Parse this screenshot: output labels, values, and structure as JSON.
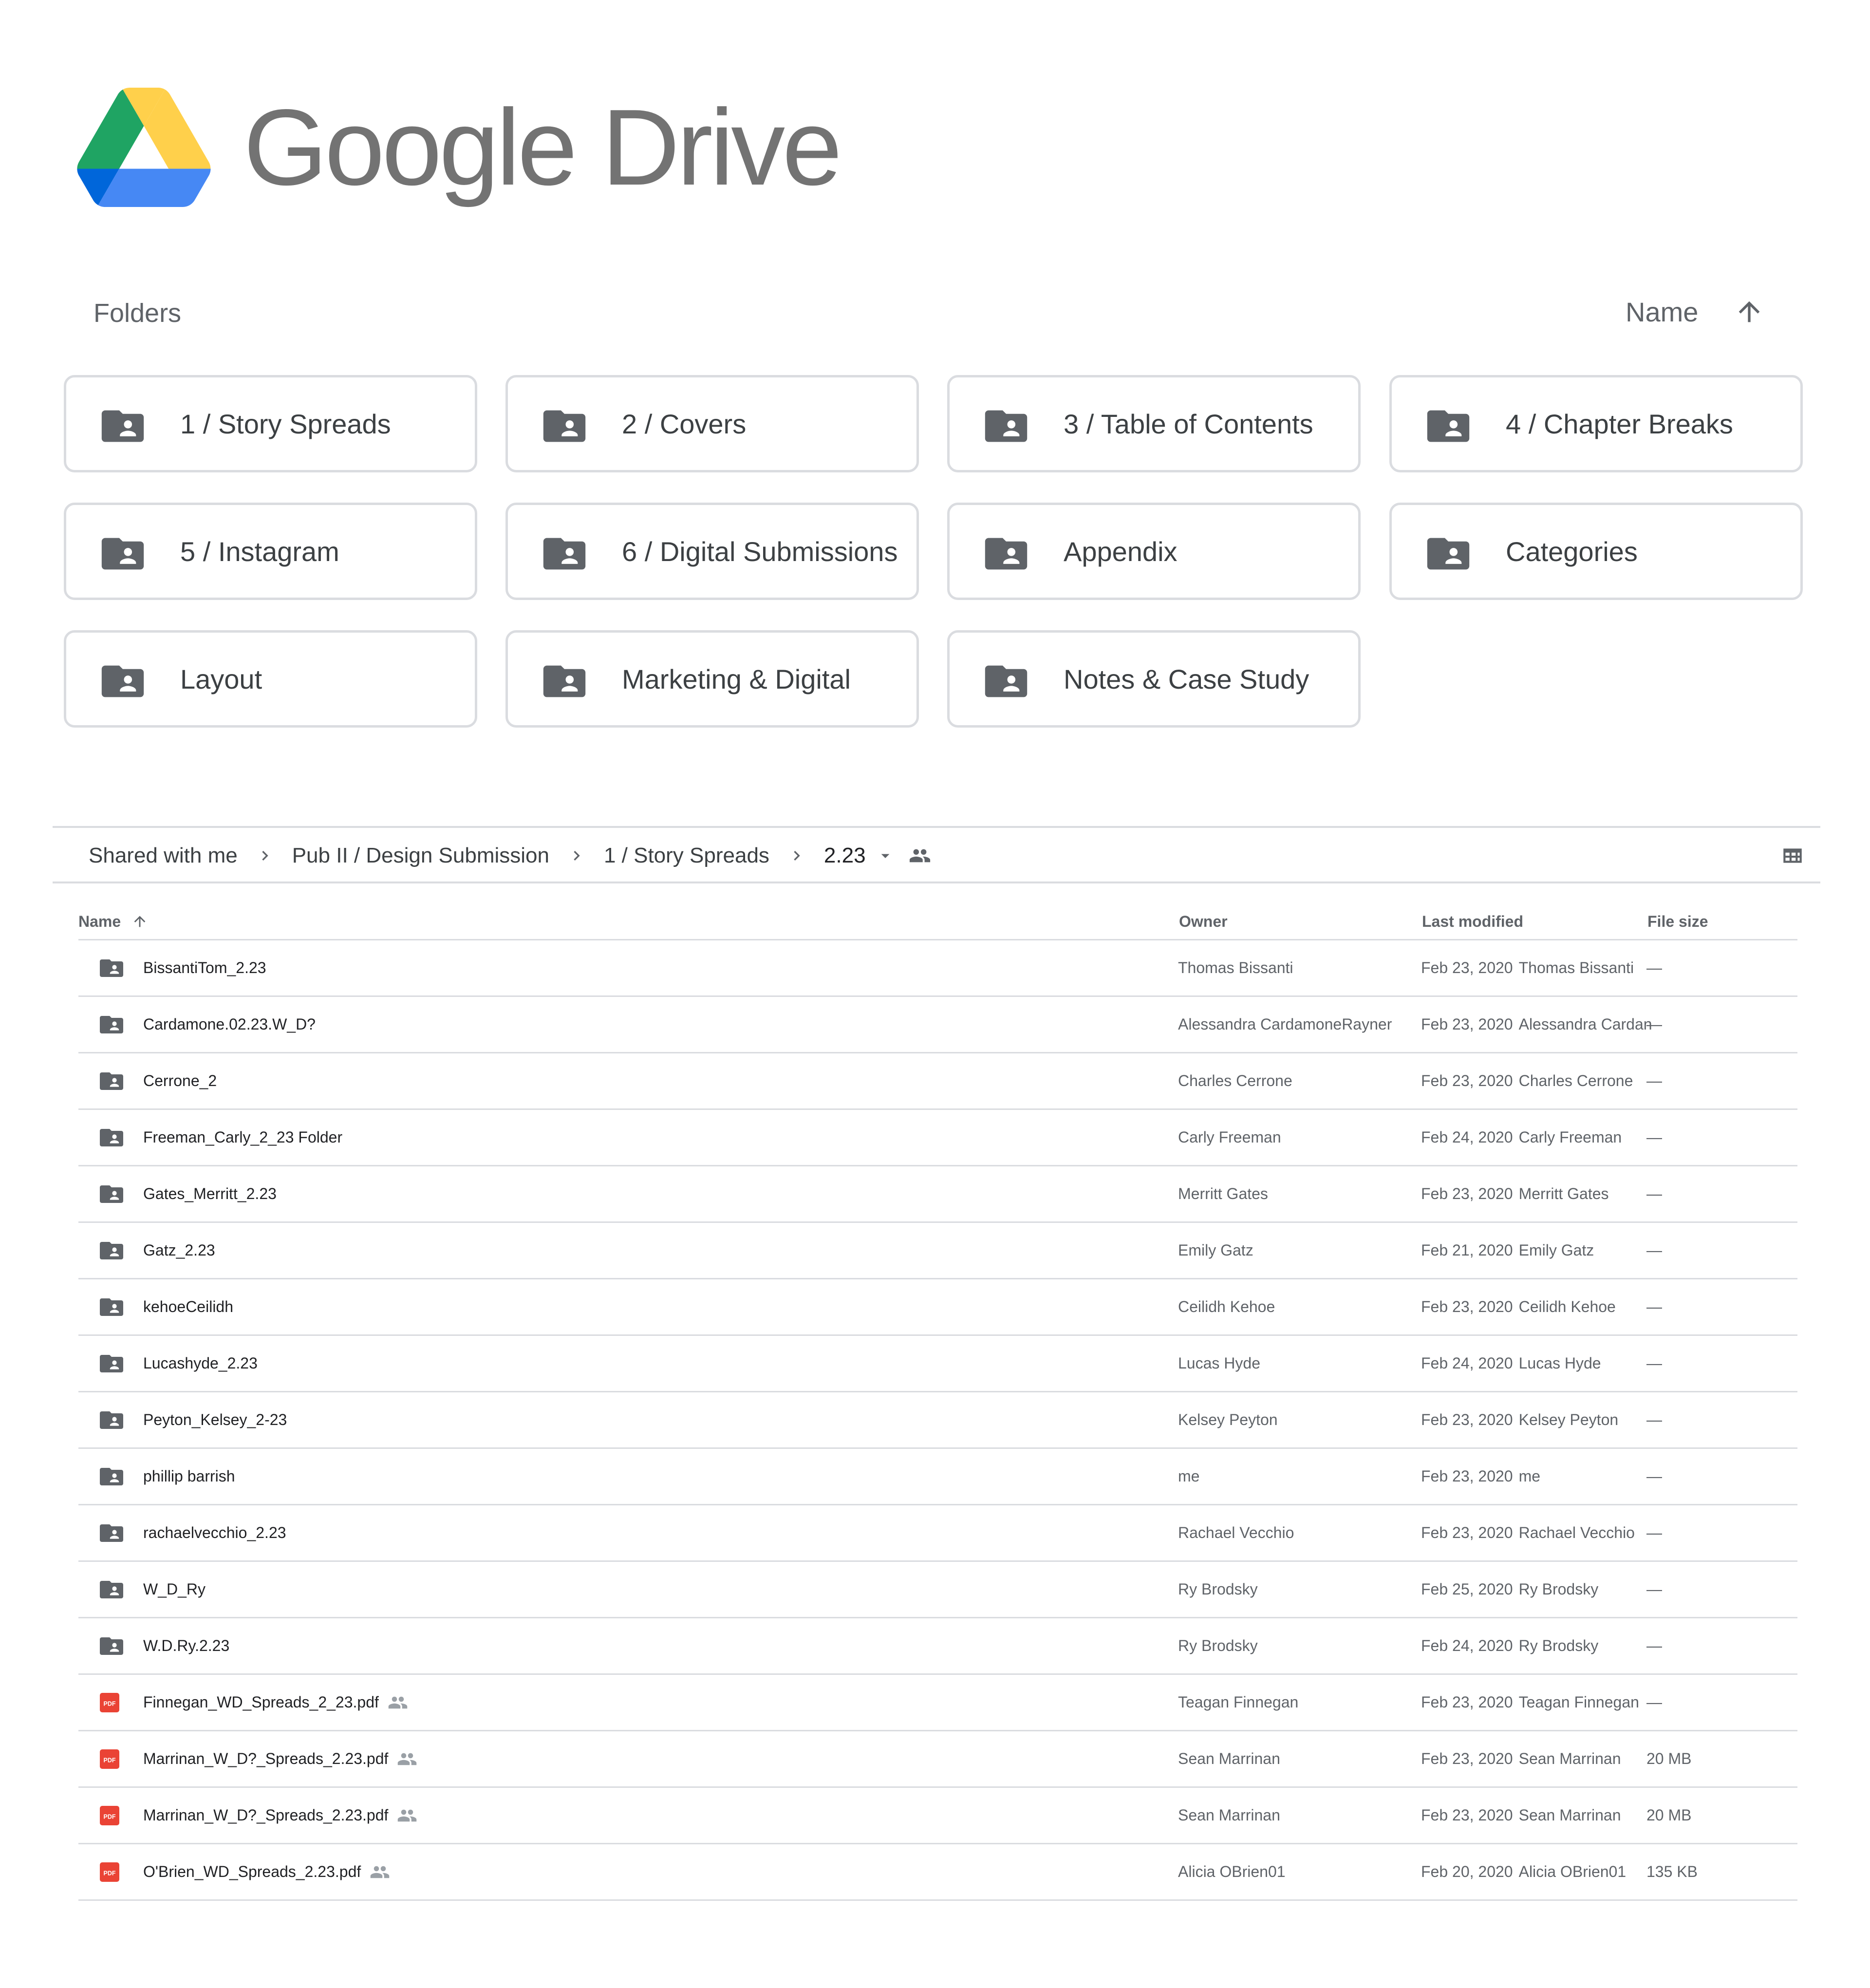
{
  "brand": {
    "name": "Google Drive",
    "logo_icon": "google-drive-logo",
    "colors": {
      "green": "#1FA463",
      "yellow": "#FFD04B",
      "blue": "#4688F4",
      "text": "#737373"
    }
  },
  "folders_section": {
    "label": "Folders",
    "sort_label": "Name",
    "sort_icon": "arrow-up-icon",
    "folders": [
      {
        "label": "1 / Story Spreads"
      },
      {
        "label": "2 / Covers"
      },
      {
        "label": "3 / Table of Contents"
      },
      {
        "label": "4 / Chapter Breaks"
      },
      {
        "label": "5 / Instagram"
      },
      {
        "label": "6 / Digital Submissions"
      },
      {
        "label": "Appendix"
      },
      {
        "label": "Categories"
      },
      {
        "label": "Layout"
      },
      {
        "label": "Marketing & Digital"
      },
      {
        "label": "Notes & Case Study"
      }
    ]
  },
  "breadcrumb": {
    "items": [
      "Shared with me",
      "Pub II / Design Submission",
      "1 / Story Spreads"
    ],
    "current": "2.23",
    "separator_icon": "chevron-right-icon",
    "dropdown_icon": "caret-down-icon",
    "shared_icon": "people-icon",
    "view_toggle_icon": "grid-view-icon"
  },
  "file_list": {
    "columns": {
      "name": "Name",
      "owner": "Owner",
      "last_modified": "Last modified",
      "file_size": "File size"
    },
    "rows": [
      {
        "type": "shared-folder",
        "name": "BissantiTom_2.23",
        "shared": false,
        "owner": "Thomas Bissanti",
        "modified_date": "Feb 23, 2020",
        "modified_by": "Thomas Bissanti",
        "size": "—"
      },
      {
        "type": "shared-folder",
        "name": "Cardamone.02.23.W_D?",
        "shared": false,
        "owner": "Alessandra CardamoneRayner",
        "modified_date": "Feb 23, 2020",
        "modified_by": "Alessandra Cardan",
        "size": "—"
      },
      {
        "type": "shared-folder",
        "name": "Cerrone_2",
        "shared": false,
        "owner": "Charles Cerrone",
        "modified_date": "Feb 23, 2020",
        "modified_by": "Charles Cerrone",
        "size": "—"
      },
      {
        "type": "shared-folder",
        "name": "Freeman_Carly_2_23 Folder",
        "shared": false,
        "owner": "Carly Freeman",
        "modified_date": "Feb 24, 2020",
        "modified_by": "Carly Freeman",
        "size": "—"
      },
      {
        "type": "shared-folder",
        "name": "Gates_Merritt_2.23",
        "shared": false,
        "owner": "Merritt Gates",
        "modified_date": "Feb 23, 2020",
        "modified_by": "Merritt Gates",
        "size": "—"
      },
      {
        "type": "shared-folder",
        "name": "Gatz_2.23",
        "shared": false,
        "owner": "Emily Gatz",
        "modified_date": "Feb 21, 2020",
        "modified_by": "Emily Gatz",
        "size": "—"
      },
      {
        "type": "shared-folder",
        "name": "kehoeCeilidh",
        "shared": false,
        "owner": "Ceilidh Kehoe",
        "modified_date": "Feb 23, 2020",
        "modified_by": "Ceilidh Kehoe",
        "size": "—"
      },
      {
        "type": "shared-folder",
        "name": "Lucashyde_2.23",
        "shared": false,
        "owner": "Lucas Hyde",
        "modified_date": "Feb 24, 2020",
        "modified_by": "Lucas Hyde",
        "size": "—"
      },
      {
        "type": "shared-folder",
        "name": "Peyton_Kelsey_2-23",
        "shared": false,
        "owner": "Kelsey Peyton",
        "modified_date": "Feb 23, 2020",
        "modified_by": "Kelsey Peyton",
        "size": "—"
      },
      {
        "type": "shared-folder",
        "name": "phillip barrish",
        "shared": false,
        "owner": "me",
        "modified_date": "Feb 23, 2020",
        "modified_by": "me",
        "size": "—"
      },
      {
        "type": "shared-folder",
        "name": "rachaelvecchio_2.23",
        "shared": false,
        "owner": "Rachael Vecchio",
        "modified_date": "Feb 23, 2020",
        "modified_by": "Rachael Vecchio",
        "size": "—"
      },
      {
        "type": "shared-folder",
        "name": "W_D_Ry",
        "shared": false,
        "owner": "Ry Brodsky",
        "modified_date": "Feb 25, 2020",
        "modified_by": "Ry Brodsky",
        "size": "—"
      },
      {
        "type": "shared-folder",
        "name": "W.D.Ry.2.23",
        "shared": false,
        "owner": "Ry Brodsky",
        "modified_date": "Feb 24, 2020",
        "modified_by": "Ry Brodsky",
        "size": "—"
      },
      {
        "type": "pdf",
        "name": "Finnegan_WD_Spreads_2_23.pdf",
        "shared": true,
        "owner": "Teagan Finnegan",
        "modified_date": "Feb 23, 2020",
        "modified_by": "Teagan Finnegan",
        "size": "—"
      },
      {
        "type": "pdf",
        "name": "Marrinan_W_D?_Spreads_2.23.pdf",
        "shared": true,
        "owner": "Sean Marrinan",
        "modified_date": "Feb 23, 2020",
        "modified_by": "Sean Marrinan",
        "size": "20 MB"
      },
      {
        "type": "pdf",
        "name": "Marrinan_W_D?_Spreads_2.23.pdf",
        "shared": true,
        "owner": "Sean Marrinan",
        "modified_date": "Feb 23, 2020",
        "modified_by": "Sean Marrinan",
        "size": "20 MB"
      },
      {
        "type": "pdf",
        "name": "O'Brien_WD_Spreads_2.23.pdf",
        "shared": true,
        "owner": "Alicia OBrien01",
        "modified_date": "Feb 20, 2020",
        "modified_by": "Alicia OBrien01",
        "size": "135 KB"
      }
    ]
  },
  "colors": {
    "folder_icon": "#5f6368",
    "pdf_icon": "#EA4335",
    "border": "#dadce0",
    "secondary_text": "#5f6368"
  }
}
